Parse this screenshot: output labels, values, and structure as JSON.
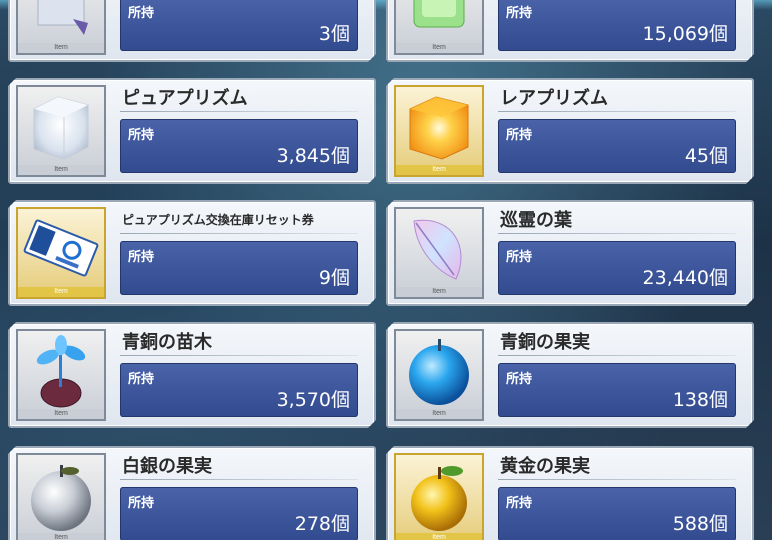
{
  "held_label": "所持",
  "item_tag": "Item",
  "items": [
    {
      "name": "",
      "quantity": "3個",
      "icon": "prism-partial-icon"
    },
    {
      "name": "",
      "quantity": "15,069個",
      "icon": "green-crystal-icon"
    },
    {
      "name": "ピュアプリズム",
      "quantity": "3,845個",
      "icon": "pure-prism-icon"
    },
    {
      "name": "レアプリズム",
      "quantity": "45個",
      "icon": "rare-prism-icon"
    },
    {
      "name": "ピュアプリズム交換在庫リセット券",
      "quantity": "9個",
      "icon": "reset-ticket-icon"
    },
    {
      "name": "巡霊の葉",
      "quantity": "23,440個",
      "icon": "spirit-leaf-icon"
    },
    {
      "name": "青銅の苗木",
      "quantity": "3,570個",
      "icon": "bronze-sapling-icon"
    },
    {
      "name": "青銅の果実",
      "quantity": "138個",
      "icon": "bronze-fruit-icon"
    },
    {
      "name": "白銀の果実",
      "quantity": "278個",
      "icon": "silver-fruit-icon"
    },
    {
      "name": "黄金の果実",
      "quantity": "588個",
      "icon": "golden-fruit-icon"
    }
  ],
  "colors": {
    "qty_panel": "#3d56a0",
    "card_bg": "#eef2f7",
    "gold_frame": "#c9a530"
  }
}
